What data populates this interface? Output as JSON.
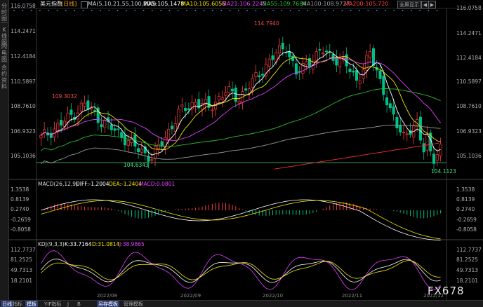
{
  "sidebar": {
    "items": [
      "分时图",
      "K线图",
      "闪电图",
      "合约资料"
    ]
  },
  "header": {
    "symbol": "美元指数",
    "period": "[日线]",
    "ma_label": "MA(5,10,21,55,100,200)",
    "ma5": "MA5:105.1478",
    "ma10": "MA10:105.6056",
    "ma21": "MA21:106.2245",
    "ma55": "MA55:109.7684",
    "ma100": "MA100:108.9727",
    "ma200": "MA200:105.720",
    "fullscreen": "全屏显示",
    "nav_prev": "◀",
    "nav_next": "▶"
  },
  "price_axis": {
    "left": [
      "116.0758",
      "114.2471",
      "112.4184",
      "110.5897",
      "108.7610",
      "106.9323",
      "105.1036"
    ],
    "right": [
      "116.0758",
      "114.2471",
      "112.4184",
      "110.5897",
      "108.7610",
      "106.9323",
      "105.1036"
    ]
  },
  "annotations": {
    "high": "114.7940",
    "low": "104.1123",
    "local_high": "109.3032",
    "local_low": "104.6343"
  },
  "macd": {
    "title": "MACD(26,12,9)",
    "diff": "DIFF:-1.2004",
    "dea": "DEA:-1.2404",
    "macd": "MACD:0.0801",
    "axis": [
      "1.3538",
      "0.8139",
      "0.2740",
      "-0.2659",
      "-0.8058"
    ]
  },
  "kdj": {
    "title": "KDJ(9,3,3)",
    "k": "K:33.7164",
    "d": "D:31.0814",
    "j": "J:38.9865",
    "axis": [
      "112.7737",
      "81.2525",
      "49.7313",
      "18.2101"
    ]
  },
  "dates": [
    "2022/08",
    "2022/09",
    "2022/10",
    "2022/11",
    "2022/12"
  ],
  "bottom_tabs": [
    "日线",
    "指标",
    "模板",
    "YIF指标",
    "J",
    "B",
    "另存模板",
    "管理模板"
  ],
  "watermark": "FX678",
  "colors": {
    "up": "#ff3b3b",
    "down": "#00c08a",
    "ma5": "#ffffff",
    "ma10": "#f2e600",
    "ma21": "#e040fb",
    "ma55": "#2ebd2e",
    "ma100": "#9a9a9a",
    "ma200": "#ff3030",
    "active_tab": "#2f3e73"
  }
}
